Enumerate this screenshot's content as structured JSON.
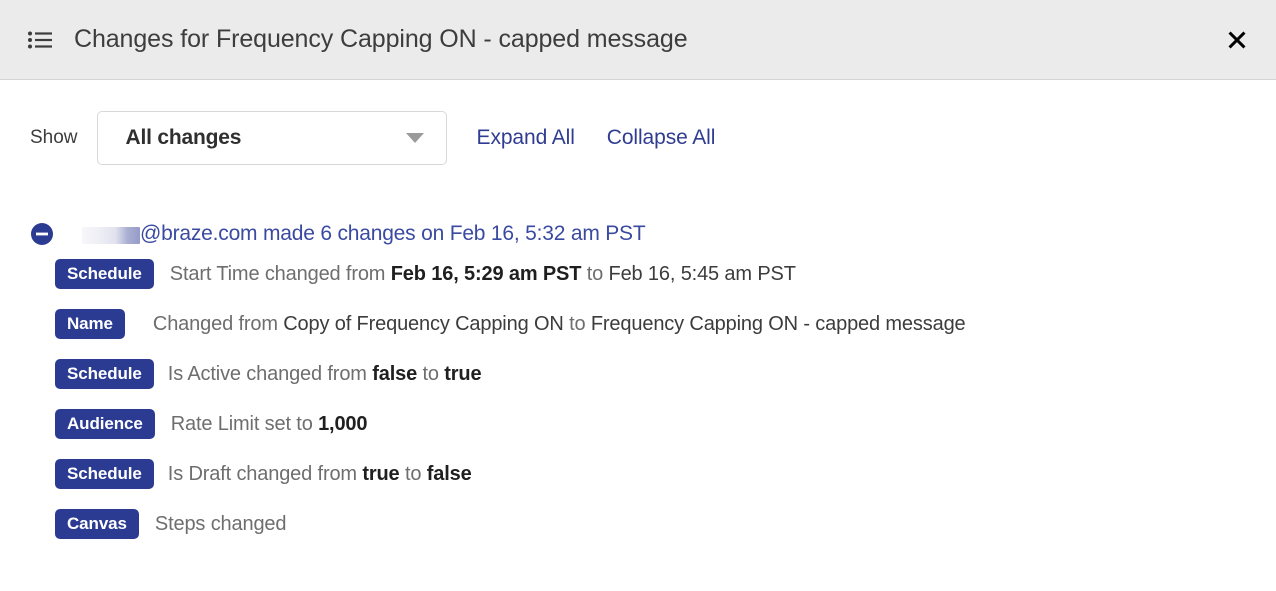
{
  "header": {
    "icon": "list-icon",
    "title": "Changes for Frequency Capping ON - capped message",
    "close_icon": "close-icon"
  },
  "toolbar": {
    "show_label": "Show",
    "filter": {
      "selected": "All changes",
      "caret_icon": "chevron-down-icon",
      "options": [
        "All changes"
      ]
    },
    "expand_all_label": "Expand All",
    "collapse_all_label": "Collapse All"
  },
  "colors": {
    "badge_background": "#2c3b92",
    "link": "#2f3c91",
    "header_background": "#ebebeb",
    "group_title": "#3a4aa0"
  },
  "change_group": {
    "toggle_icon": "minus-circle-icon",
    "toggle_state": "expanded",
    "author_redacted": true,
    "title": "@braze.com made 6 changes on Feb 16, 5:32 am PST",
    "changes": [
      {
        "badge": "Schedule",
        "segments": [
          {
            "text": "Start Time changed from ",
            "style": "normal"
          },
          {
            "text": "Feb 16, 5:29 am PST",
            "style": "bold"
          },
          {
            "text": " to ",
            "style": "normal"
          },
          {
            "text": "Feb 16, 5:45 am PST",
            "style": "plain-dark"
          }
        ]
      },
      {
        "badge": "Name",
        "segments": [
          {
            "text": "Changed from ",
            "style": "normal"
          },
          {
            "text": "Copy of Frequency Capping ON",
            "style": "plain-dark"
          },
          {
            "text": " to ",
            "style": "normal"
          },
          {
            "text": "Frequency Capping ON - capped message",
            "style": "plain-dark"
          }
        ]
      },
      {
        "badge": "Schedule",
        "segments": [
          {
            "text": "Is Active changed from ",
            "style": "normal"
          },
          {
            "text": "false",
            "style": "bold"
          },
          {
            "text": " to ",
            "style": "normal"
          },
          {
            "text": "true",
            "style": "bold"
          }
        ]
      },
      {
        "badge": "Audience",
        "segments": [
          {
            "text": "Rate Limit set to ",
            "style": "normal"
          },
          {
            "text": "1,000",
            "style": "bold"
          }
        ]
      },
      {
        "badge": "Schedule",
        "segments": [
          {
            "text": "Is Draft changed from ",
            "style": "normal"
          },
          {
            "text": "true",
            "style": "bold"
          },
          {
            "text": " to ",
            "style": "normal"
          },
          {
            "text": "false",
            "style": "bold"
          }
        ]
      },
      {
        "badge": "Canvas",
        "segments": [
          {
            "text": "Steps changed",
            "style": "normal"
          }
        ]
      }
    ]
  }
}
